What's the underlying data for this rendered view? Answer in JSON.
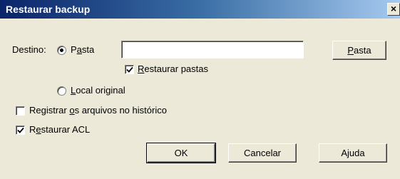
{
  "dialog": {
    "title": "Restaurar backup",
    "close_glyph": "×"
  },
  "destination": {
    "label": "Destino:",
    "option_folder": {
      "pre": "P",
      "accel": "a",
      "post": "sta",
      "selected": true
    },
    "option_original": {
      "pre": "",
      "accel": "L",
      "post": "ocal original",
      "selected": false
    },
    "folder_path": {
      "value": "",
      "placeholder": ""
    },
    "browse_button": {
      "pre": "",
      "accel": "P",
      "post": "asta"
    },
    "restore_folders": {
      "pre": "",
      "accel": "R",
      "post": "estaurar pastas",
      "checked": true
    }
  },
  "options": {
    "log_files": {
      "pre": "Registrar ",
      "accel": "o",
      "post": "s arquivos no histórico",
      "checked": false
    },
    "restore_acl": {
      "pre": "R",
      "accel": "e",
      "post": "staurar ACL",
      "checked": true
    }
  },
  "buttons": {
    "ok": "OK",
    "cancel": "Cancelar",
    "help": "Ajuda"
  },
  "icons": {
    "close": "close-icon",
    "check": "checkmark-icon"
  }
}
